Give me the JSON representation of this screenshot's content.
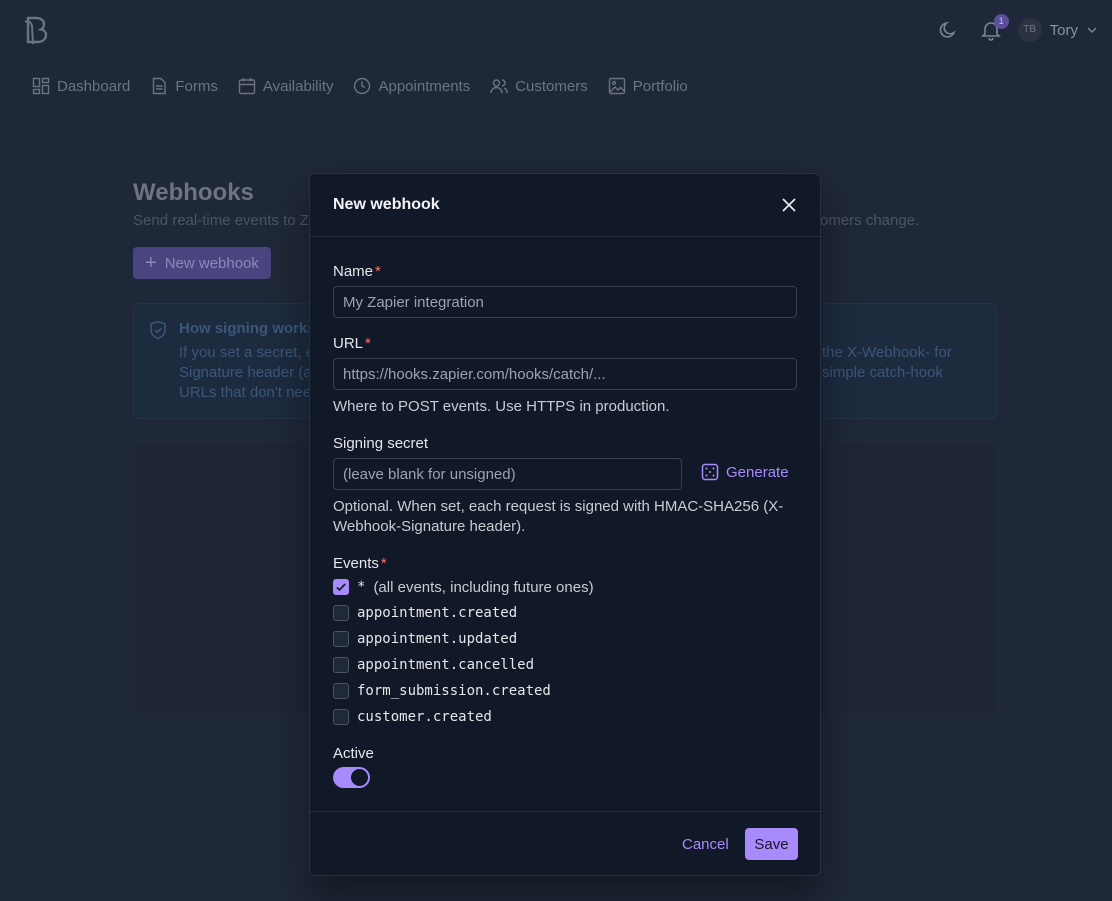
{
  "header": {
    "user_initials": "TB",
    "user_name": "Tory",
    "notification_count": "1"
  },
  "nav": {
    "items": [
      {
        "label": "Dashboard",
        "icon": "dashboard-icon"
      },
      {
        "label": "Forms",
        "icon": "document-icon"
      },
      {
        "label": "Availability",
        "icon": "calendar-icon"
      },
      {
        "label": "Appointments",
        "icon": "clock-icon"
      },
      {
        "label": "Customers",
        "icon": "users-icon"
      },
      {
        "label": "Portfolio",
        "icon": "image-icon"
      }
    ]
  },
  "page": {
    "title": "Webhooks",
    "subtitle_left": "Send real-time events to Za",
    "subtitle_right": "omers change.",
    "new_button_label": "New webhook",
    "info_title": "How signing works",
    "info_text_left": "If you set a secret, e Signature header (a URLs that don't nee",
    "info_text_right": "the X-Webhook- for simple catch-hook"
  },
  "modal": {
    "title": "New webhook",
    "name_label": "Name",
    "name_placeholder": "My Zapier integration",
    "url_label": "URL",
    "url_placeholder": "https://hooks.zapier.com/hooks/catch/...",
    "url_help": "Where to POST events. Use HTTPS in production.",
    "secret_label": "Signing secret",
    "secret_placeholder": "(leave blank for unsigned)",
    "generate_label": "Generate",
    "secret_help": "Optional. When set, each request is signed with HMAC-SHA256 (X-Webhook-Signature header).",
    "events_label": "Events",
    "events": [
      {
        "name": "*",
        "desc": "(all events, including future ones)",
        "checked": true
      },
      {
        "name": "appointment.created",
        "desc": "",
        "checked": false
      },
      {
        "name": "appointment.updated",
        "desc": "",
        "checked": false
      },
      {
        "name": "appointment.cancelled",
        "desc": "",
        "checked": false
      },
      {
        "name": "form_submission.created",
        "desc": "",
        "checked": false
      },
      {
        "name": "customer.created",
        "desc": "",
        "checked": false
      }
    ],
    "active_label": "Active",
    "active": true,
    "cancel_label": "Cancel",
    "save_label": "Save",
    "required_mark": "*"
  },
  "colors": {
    "accent": "#a78bfa",
    "background": "#1f2838",
    "modal_bg": "#111827",
    "required": "#f87171"
  }
}
